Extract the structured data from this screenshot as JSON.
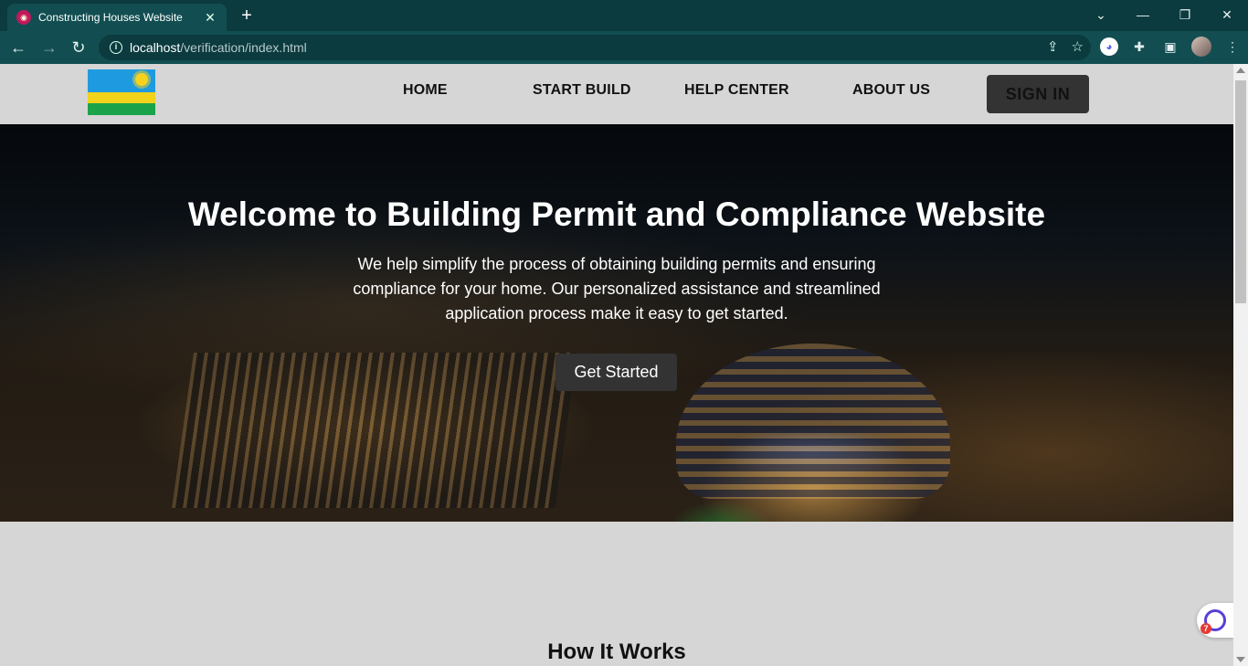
{
  "browser": {
    "tab_title": "Constructing Houses Website",
    "tab_close": "✕",
    "new_tab": "+",
    "url_host": "localhost",
    "url_path": "/verification/index.html",
    "icons": [
      "back-icon",
      "forward-icon",
      "reload-icon",
      "info-icon",
      "share-icon",
      "star-icon",
      "discord-extension-icon",
      "puzzle-icon",
      "side-panel-icon",
      "profile-avatar",
      "kebab-menu-icon"
    ]
  },
  "window": {
    "minimize": "—",
    "restore": "❐",
    "close": "✕",
    "tabs_dropdown": "⌄"
  },
  "nav": {
    "home": "HOME",
    "start_build": "START BUILD",
    "help_center": "HELP CENTER",
    "about_us": "ABOUT US",
    "sign_in": "SIGN IN"
  },
  "hero": {
    "title": "Welcome to Building Permit and Compliance Website",
    "text": "We help simplify the process of obtaining building permits and ensuring compliance for your home. Our personalized assistance and streamlined application process make it easy to get started.",
    "cta": "Get Started"
  },
  "section": {
    "how_title": "How It Works"
  },
  "floating": {
    "badge_count": "7"
  },
  "colors": {
    "browser_frame": "#0b3b3f",
    "toolbar": "#124e51",
    "page_bg": "#d6d6d6",
    "button_dark": "#333333"
  }
}
